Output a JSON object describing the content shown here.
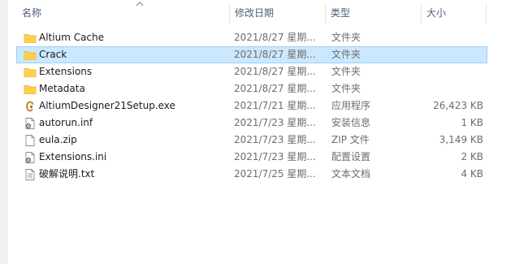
{
  "columns": {
    "name": "名称",
    "date": "修改日期",
    "type": "类型",
    "size": "大小"
  },
  "files": [
    {
      "name": "Altium Cache",
      "date": "2021/8/27 星期...",
      "type": "文件夹",
      "size": "",
      "icon": "folder-icon"
    },
    {
      "name": "Crack",
      "date": "2021/8/27 星期...",
      "type": "文件夹",
      "size": "",
      "icon": "folder-icon",
      "selected": true
    },
    {
      "name": "Extensions",
      "date": "2021/8/27 星期...",
      "type": "文件夹",
      "size": "",
      "icon": "folder-icon"
    },
    {
      "name": "Metadata",
      "date": "2021/8/27 星期...",
      "type": "文件夹",
      "size": "",
      "icon": "folder-icon"
    },
    {
      "name": "AltiumDesigner21Setup.exe",
      "date": "2021/7/21 星期...",
      "type": "应用程序",
      "size": "26,423 KB",
      "icon": "altium-app-icon"
    },
    {
      "name": "autorun.inf",
      "date": "2021/7/23 星期...",
      "type": "安装信息",
      "size": "1 KB",
      "icon": "settings-file-icon"
    },
    {
      "name": "eula.zip",
      "date": "2021/7/23 星期...",
      "type": "ZIP 文件",
      "size": "3,149 KB",
      "icon": "blank-file-icon"
    },
    {
      "name": "Extensions.ini",
      "date": "2021/7/23 星期...",
      "type": "配置设置",
      "size": "2 KB",
      "icon": "settings-file-icon"
    },
    {
      "name": "破解说明.txt",
      "date": "2021/7/25 星期...",
      "type": "文本文档",
      "size": "4 KB",
      "icon": "text-file-icon"
    }
  ],
  "colors": {
    "selection_bg": "#cce8ff",
    "selection_border": "#99d1ff",
    "header_text": "#4c607a",
    "folder": "#ffd45f",
    "altium": "#c8933e"
  }
}
